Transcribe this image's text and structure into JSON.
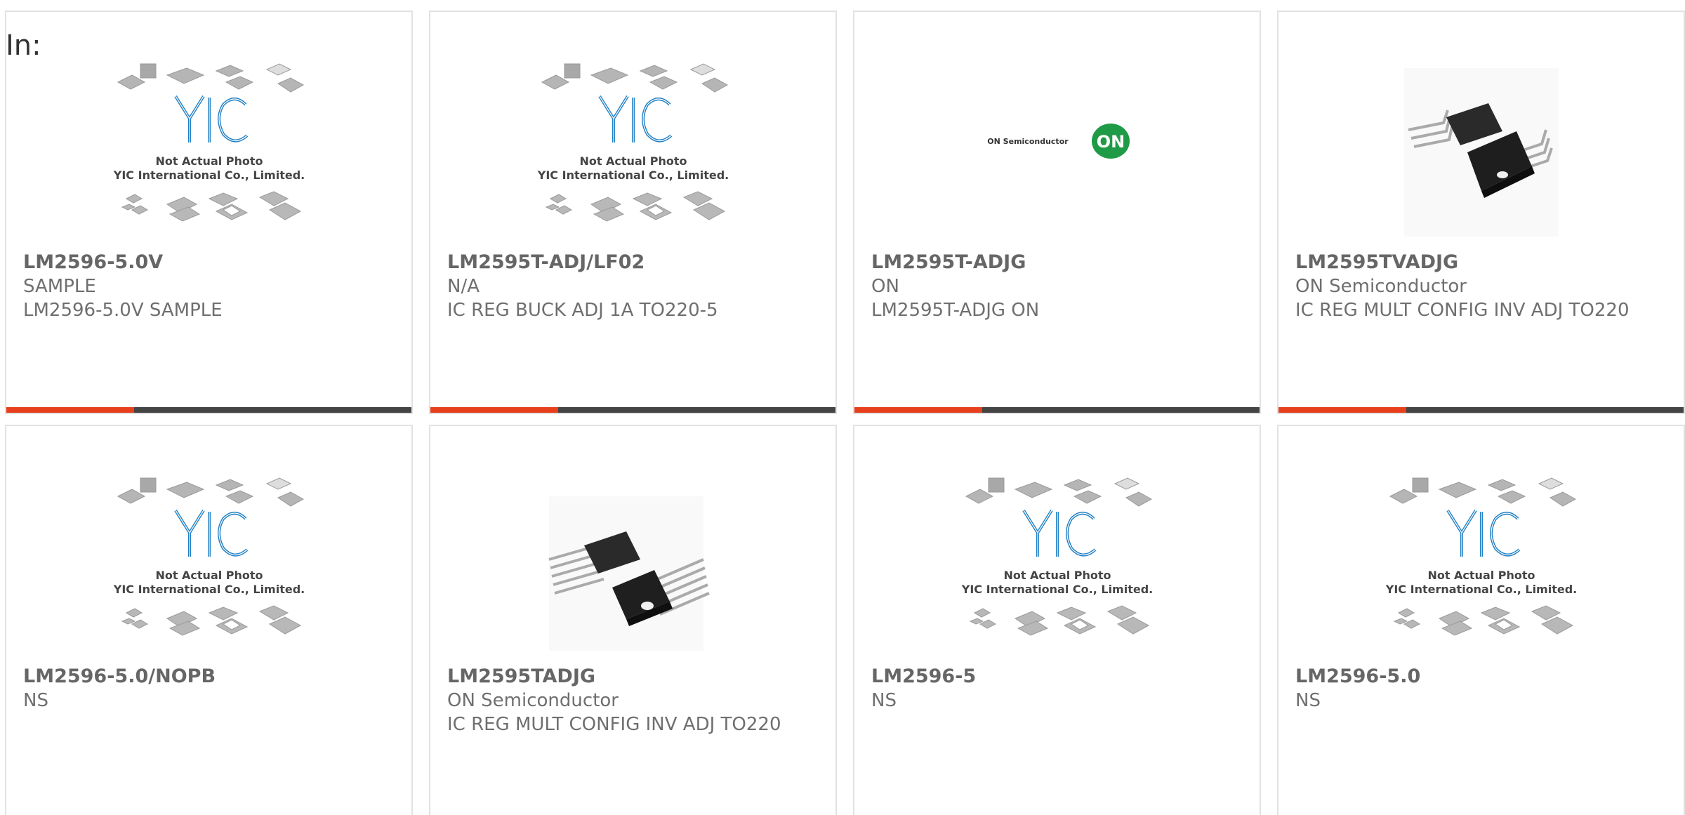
{
  "filter": {
    "label": "In:"
  },
  "placeholder": {
    "logo_text": "YIC",
    "line1": "Not Actual Photo",
    "line2": "YIC International Co., Limited."
  },
  "brand_logo": {
    "text": "ON Semiconductor",
    "badge": "ON",
    "badge_color": "#1f9a46"
  },
  "colors": {
    "accent": "#e8401c",
    "bar": "#444444",
    "border": "#e2e2e2",
    "text": "#6f6f6f",
    "logo_blue": "#1f7fc4"
  },
  "products": [
    {
      "part": "LM2596-5.0V",
      "mfr": "SAMPLE",
      "desc": "LM2596-5.0V SAMPLE",
      "image": "placeholder"
    },
    {
      "part": "LM2595T-ADJ/LF02",
      "mfr": "N/A",
      "desc": "IC REG BUCK ADJ 1A TO220-5",
      "image": "placeholder"
    },
    {
      "part": "LM2595T-ADJG",
      "mfr": "ON",
      "desc": "LM2595T-ADJG ON",
      "image": "on-logo"
    },
    {
      "part": "LM2595TVADJG",
      "mfr": "ON Semiconductor",
      "desc": "IC REG MULT CONFIG INV ADJ TO220",
      "image": "to220-bent"
    },
    {
      "part": "LM2596-5.0/NOPB",
      "mfr": "NS",
      "desc": "",
      "image": "placeholder"
    },
    {
      "part": "LM2595TADJG",
      "mfr": "ON Semiconductor",
      "desc": "IC REG MULT CONFIG INV ADJ TO220",
      "image": "to220-straight"
    },
    {
      "part": "LM2596-5",
      "mfr": "NS",
      "desc": "",
      "image": "placeholder"
    },
    {
      "part": "LM2596-5.0",
      "mfr": "NS",
      "desc": "",
      "image": "placeholder"
    }
  ]
}
